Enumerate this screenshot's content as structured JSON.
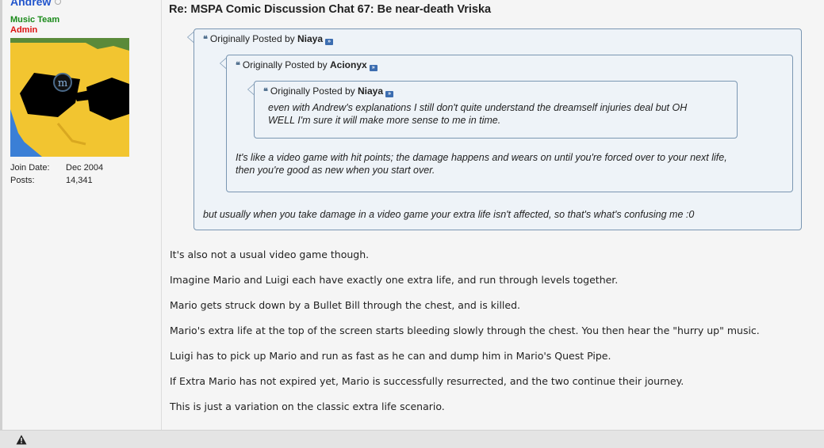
{
  "user": {
    "name": "Andrew",
    "title": "Music Team",
    "rank": "Admin",
    "join_label": "Join Date:",
    "join_value": "Dec 2004",
    "posts_label": "Posts:",
    "posts_value": "14,341"
  },
  "post": {
    "title": "Re: MSPA Comic Discussion Chat 67: Be near-death Vriska",
    "quotes": [
      {
        "prefix": "Originally Posted by",
        "author": "Niaya",
        "body": "but usually when you take damage in a video game your extra life isn't affected, so that's what's confusing me :0"
      },
      {
        "prefix": "Originally Posted by",
        "author": "Acionyx",
        "body_lines": [
          "It's like a video game with hit points; the damage happens and wears on until you're forced over to your next life,",
          "then you're good as new when you start over."
        ]
      },
      {
        "prefix": "Originally Posted by",
        "author": "Niaya",
        "body_lines": [
          "even with Andrew's explanations I still don't quite understand the dreamself injuries deal but OH",
          "WELL I'm sure it will make more sense to me in time."
        ]
      }
    ],
    "paragraphs": [
      "It's also not a usual video game though.",
      "Imagine Mario and Luigi each have exactly one extra life, and run through levels together.",
      "Mario gets struck down by a Bullet Bill through the chest, and is killed.",
      "Mario's extra life at the top of the screen starts bleeding slowly through the chest. You then hear the \"hurry up\" music.",
      "Luigi has to pick up Mario and run as fast as he can and dump him in Mario's Quest Pipe.",
      "If Extra Mario has not expired yet, Mario is successfully resurrected, and the two continue their journey.",
      "This is just a variation on the classic extra life scenario."
    ]
  },
  "icons": {
    "online_status": "offline-circle-icon",
    "quote": "quote-icon",
    "view_post": "view-post-icon",
    "report": "warning-icon"
  },
  "colors": {
    "username": "#2255cc",
    "title": "#1a8a1a",
    "rank": "#dd1111",
    "quote_bg": "#eef3f8",
    "quote_border": "#7a96b2"
  }
}
